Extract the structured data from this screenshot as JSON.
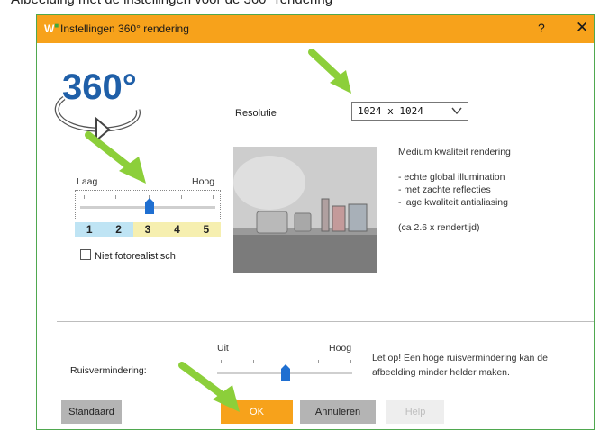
{
  "caption_top": "Afbeelding met de instellingen voor de 360° rendering",
  "window": {
    "title": "Instellingen 360° rendering",
    "app_icon": "W",
    "help_label": "?",
    "close_label": "✕"
  },
  "logo": {
    "text": "360°"
  },
  "resolution": {
    "label": "Resolutie",
    "value": "1024 x 1024"
  },
  "quality": {
    "low_label": "Laag",
    "high_label": "Hoog",
    "levels": [
      "1",
      "2",
      "3",
      "4",
      "5"
    ],
    "selected_level": 3
  },
  "non_photorealistic": {
    "label": "Niet fotorealistisch",
    "checked": false
  },
  "preview_info": {
    "heading": "Medium kwaliteit rendering",
    "bullets": [
      "- echte global illumination",
      "- met zachte reflecties",
      "- lage kwaliteit antialiasing"
    ],
    "note": "(ca 2.6 x rendertijd)"
  },
  "noise_reduction": {
    "label": "Ruisvermindering:",
    "low_label": "Uit",
    "high_label": "Hoog",
    "level_fraction": 0.5,
    "warning_line1": "Let op! Een hoge ruisvermindering kan de",
    "warning_line2": "afbeelding minder helder maken."
  },
  "buttons": {
    "standard": "Standaard",
    "ok": "OK",
    "cancel": "Annuleren",
    "help": "Help"
  },
  "colors": {
    "titlebar": "#f7a21b",
    "ok_button": "#f7a21b",
    "slider_thumb": "#1f6fd1",
    "annotation_arrow": "#8ccf3a",
    "dialog_border": "#4fa84f"
  }
}
